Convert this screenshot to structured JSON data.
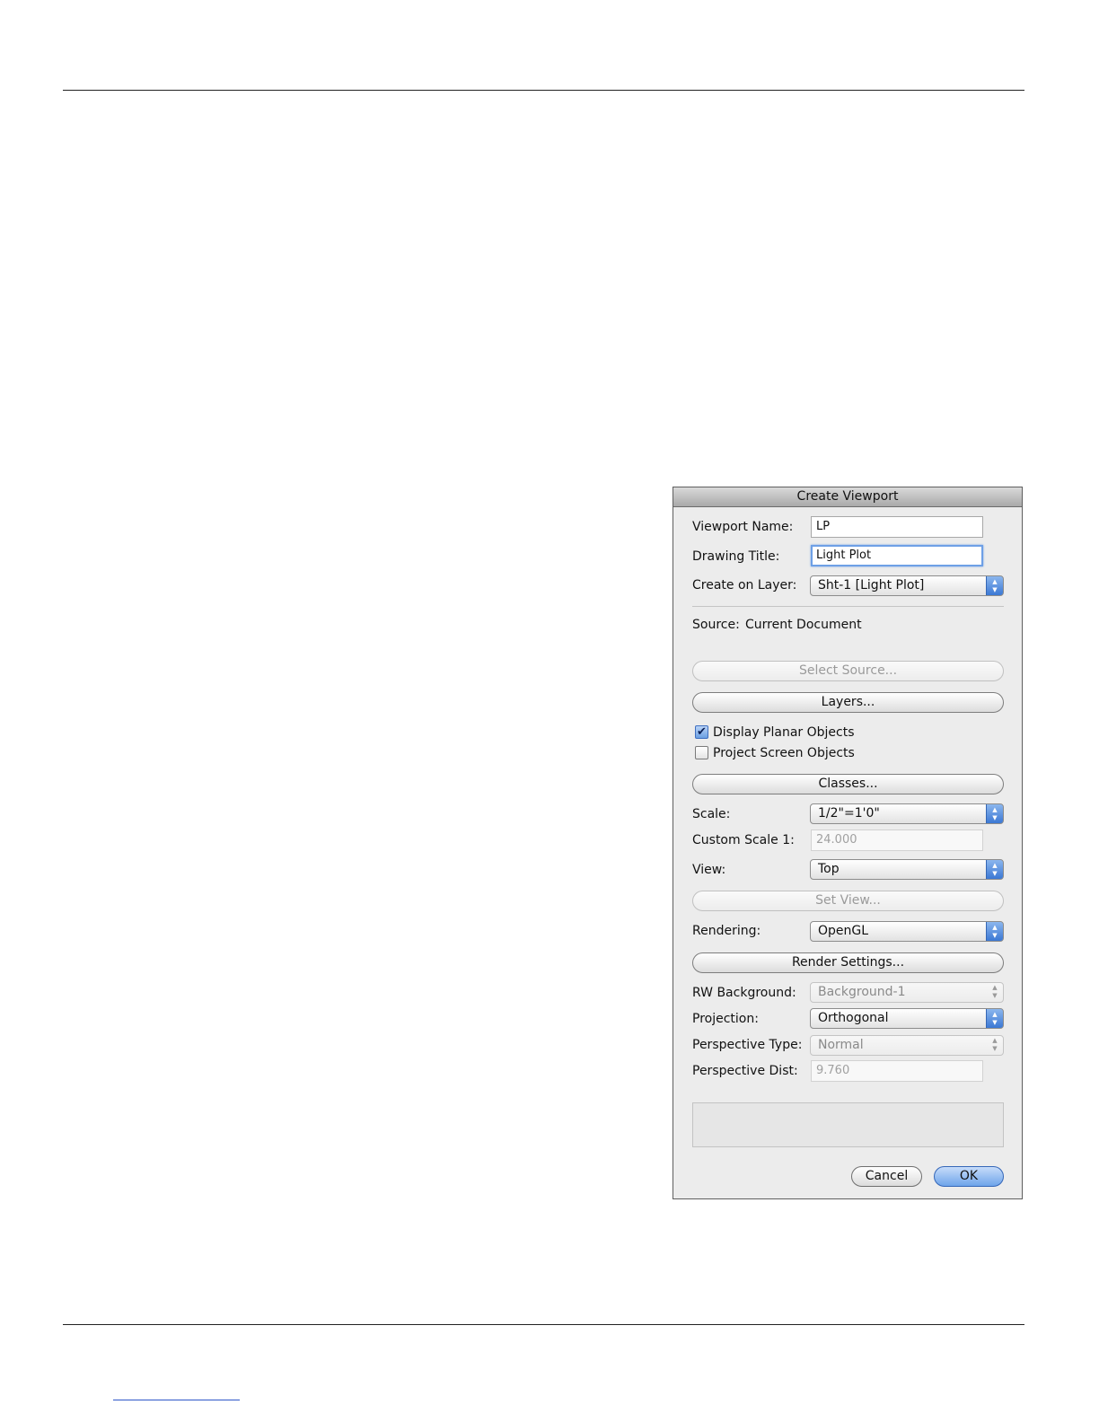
{
  "dialog": {
    "title": "Create Viewport",
    "viewport_name": {
      "label": "Viewport Name:",
      "value": "LP"
    },
    "drawing_title": {
      "label": "Drawing Title:",
      "value": "Light Plot"
    },
    "create_on_layer": {
      "label": "Create on Layer:",
      "value": "Sht-1 [Light Plot]"
    },
    "source": {
      "label": "Source:",
      "value": "Current Document"
    },
    "select_source_button": "Select Source...",
    "layers_button": "Layers...",
    "display_planar_objects": {
      "label": "Display Planar Objects",
      "checked": true
    },
    "project_screen_objects": {
      "label": "Project Screen Objects",
      "checked": false
    },
    "classes_button": "Classes...",
    "scale": {
      "label": "Scale:",
      "value": "1/2\"=1'0\""
    },
    "custom_scale": {
      "label": "Custom Scale 1:",
      "value": "24.000"
    },
    "view": {
      "label": "View:",
      "value": "Top"
    },
    "set_view_button": "Set View...",
    "rendering": {
      "label": "Rendering:",
      "value": "OpenGL"
    },
    "render_settings_button": "Render Settings...",
    "rw_background": {
      "label": "RW Background:",
      "value": "Background-1"
    },
    "projection": {
      "label": "Projection:",
      "value": "Orthogonal"
    },
    "perspective_type": {
      "label": "Perspective Type:",
      "value": "Normal"
    },
    "perspective_dist": {
      "label": "Perspective Dist:",
      "value": "9.760"
    },
    "cancel_button": "Cancel",
    "ok_button": "OK"
  },
  "colors": {
    "accent": "#6ea4ea",
    "dialog_background": "#ececec"
  },
  "icons": {
    "checkmark": "✔",
    "popup_arrows": "▲▼"
  }
}
